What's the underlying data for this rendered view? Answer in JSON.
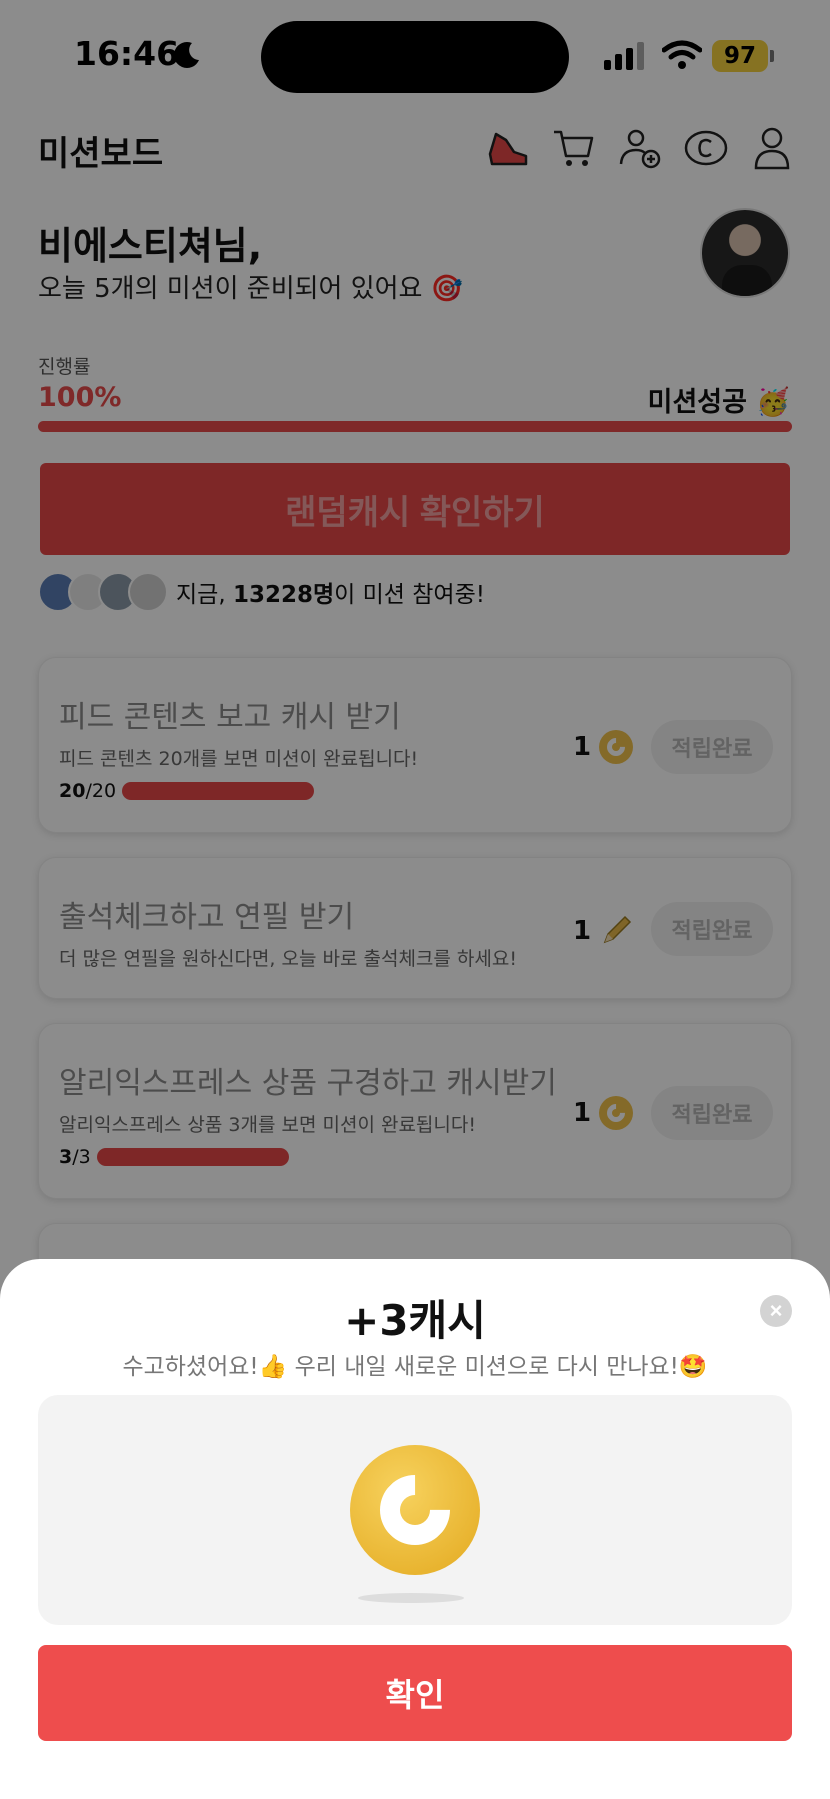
{
  "status_bar": {
    "time": "16:46",
    "battery": "97"
  },
  "header": {
    "title": "미션보드",
    "icons": [
      "sneaker-icon",
      "cart-icon",
      "add-user-icon",
      "cash-coin-icon",
      "profile-icon"
    ]
  },
  "greeting": {
    "name": "비에스티쳐님,",
    "subtitle": "오늘 5개의 미션이 준비되어 있어요 🎯"
  },
  "progress": {
    "label": "진행률",
    "percent_text": "100%",
    "fraction": 1.0,
    "status": "미션성공 🥳"
  },
  "random_cash_button": "랜덤캐시 확인하기",
  "participants": {
    "prefix": "지금, ",
    "count": "13228명",
    "suffix": "이 미션 참여중!"
  },
  "missions": [
    {
      "title": "피드 콘텐츠 보고 캐시 받기",
      "description": "피드 콘텐츠 20개를 보면 미션이 완료됩니다!",
      "progress_done": "20",
      "progress_total": "/20",
      "progress_fraction": 1.0,
      "reward": "1",
      "reward_icon": "coin-icon",
      "button": "적립완료"
    },
    {
      "title": "출석체크하고 연필 받기",
      "description": "더 많은 연필을 원하신다면, 오늘 바로 출석체크를 하세요!",
      "reward": "1",
      "reward_icon": "pencil-icon",
      "button": "적립완료"
    },
    {
      "title": "알리익스프레스 상품 구경하고 캐시받기",
      "description": "알리익스프레스 상품 3개를 보면 미션이 완료됩니다!",
      "progress_done": "3",
      "progress_total": "/3",
      "progress_fraction": 1.0,
      "reward": "1",
      "reward_icon": "coin-icon",
      "button": "적립완료"
    }
  ],
  "sheet": {
    "title": "+3캐시",
    "subtitle": "수고하셨어요!👍 우리 내일 새로운 미션으로 다시 만나요!🤩",
    "close_icon": "×",
    "confirm": "확인"
  },
  "colors": {
    "accent": "#e74c4c",
    "coin": "#f0c14b",
    "confirm": "#ee4d4d"
  }
}
